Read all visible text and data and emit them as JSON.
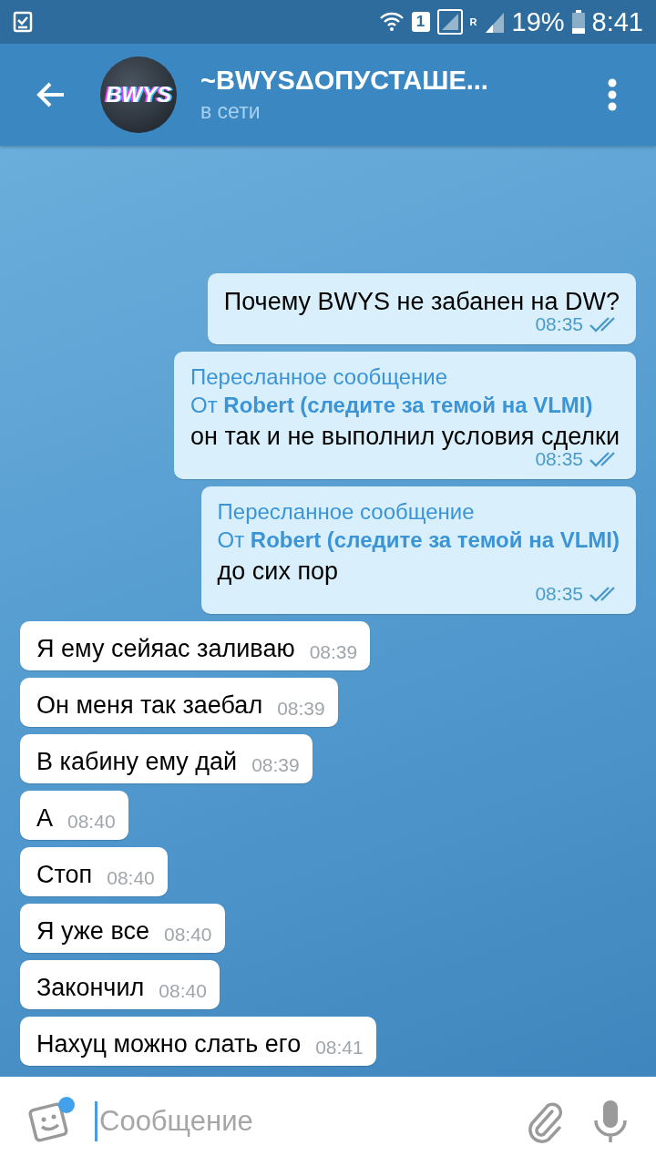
{
  "status_bar": {
    "battery": "19%",
    "time": "8:41",
    "sim": "1",
    "roaming": "R"
  },
  "header": {
    "avatar_text": "BWYS",
    "title": "~BWYSΔОПУСТАШЕ...",
    "subtitle": "в сети"
  },
  "messages": [
    {
      "kind": "outgoing",
      "text": "Почему BWYS не забанен на DW?",
      "time": "08:35",
      "read": true
    },
    {
      "kind": "outgoing",
      "forward_label": "Пересланное сообщение",
      "forward_from": "От **Robert (следите за темой на VLMI)**",
      "text": "он так и не выполнил условия сделки",
      "time": "08:35",
      "read": true
    },
    {
      "kind": "outgoing",
      "forward_label": "Пересланное сообщение",
      "forward_from": "От **Robert (следите за темой на VLMI)**",
      "text": "до сих пор",
      "time": "08:35",
      "read": true
    },
    {
      "kind": "incoming",
      "text": "Я ему сейяас заливаю",
      "time": "08:39"
    },
    {
      "kind": "incoming",
      "text": "Он меня так заебал",
      "time": "08:39"
    },
    {
      "kind": "incoming",
      "text": "В кабину ему дай",
      "time": "08:39"
    },
    {
      "kind": "incoming",
      "text": "А",
      "time": "08:40"
    },
    {
      "kind": "incoming",
      "text": "Стоп",
      "time": "08:40"
    },
    {
      "kind": "incoming",
      "text": "Я уже все",
      "time": "08:40"
    },
    {
      "kind": "incoming",
      "text": "Закончил",
      "time": "08:40"
    },
    {
      "kind": "incoming",
      "text": "Нахуц можно слать его",
      "time": "08:41"
    }
  ],
  "composer": {
    "placeholder": "Сообщение",
    "sticker_badge": true
  }
}
